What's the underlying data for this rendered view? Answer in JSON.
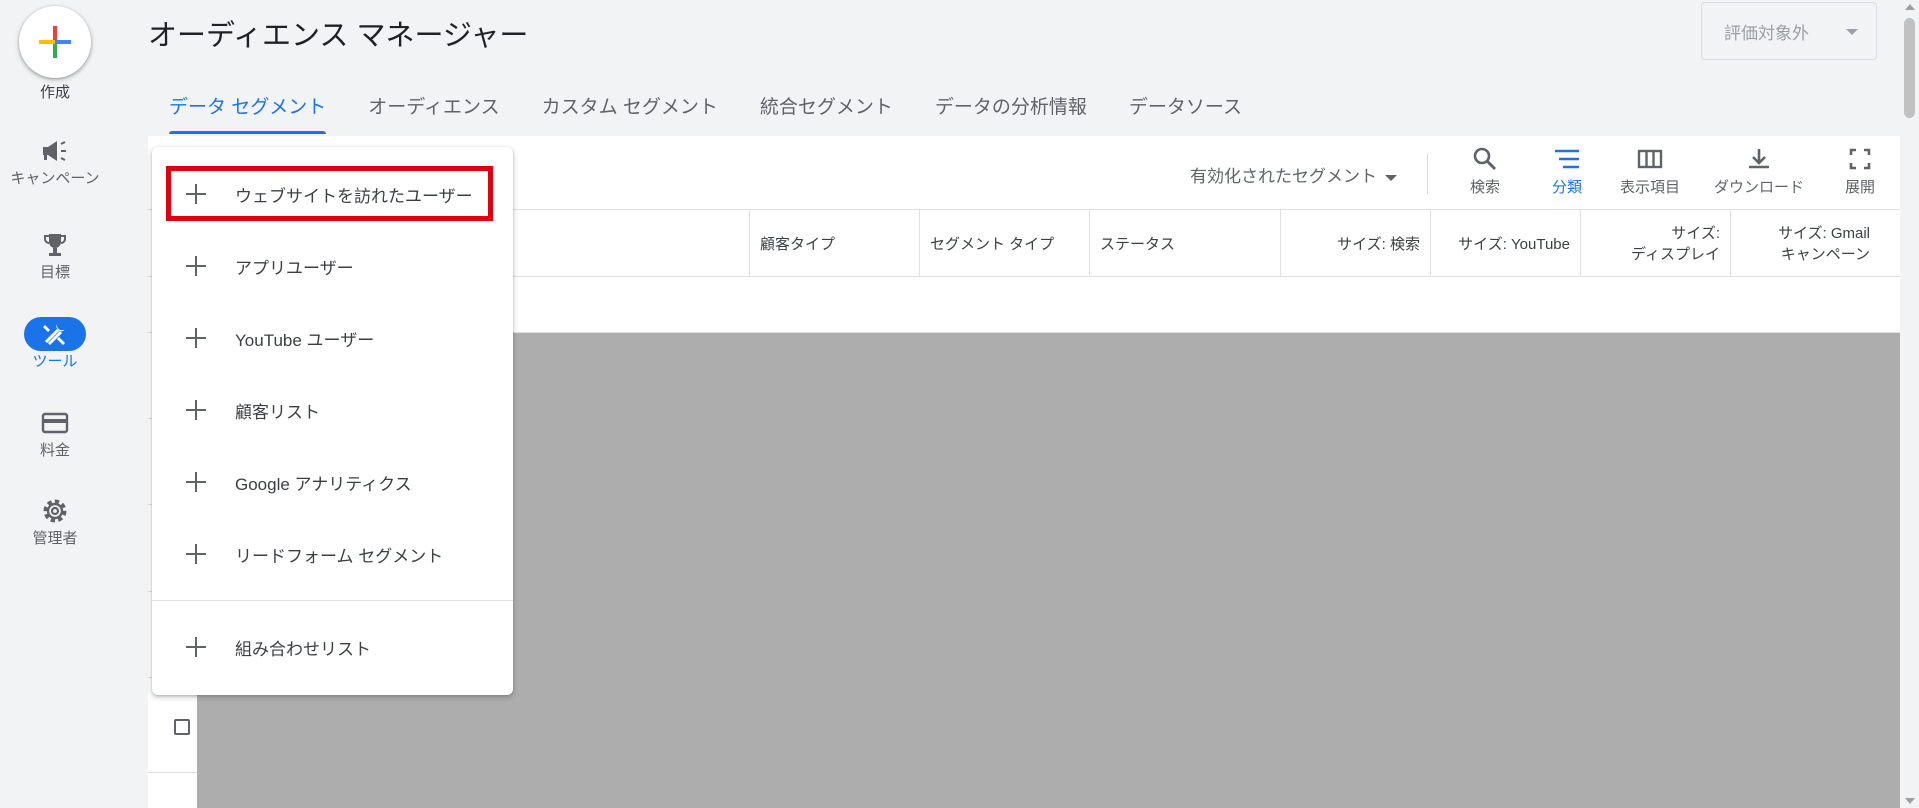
{
  "rail": {
    "create_label": "作成",
    "items": [
      {
        "label": "キャンペーン",
        "icon": "megaphone-icon",
        "active": false
      },
      {
        "label": "目標",
        "icon": "trophy-icon",
        "active": false
      },
      {
        "label": "ツール",
        "icon": "tools-icon",
        "active": true
      },
      {
        "label": "料金",
        "icon": "credit-card-icon",
        "active": false
      },
      {
        "label": "管理者",
        "icon": "gear-icon",
        "active": false
      }
    ]
  },
  "header": {
    "title": "オーディエンス マネージャー",
    "eval_dropdown": "評価対象外"
  },
  "tabs": [
    {
      "label": "データ セグメント",
      "active": true
    },
    {
      "label": "オーディエンス",
      "active": false
    },
    {
      "label": "カスタム セグメント",
      "active": false
    },
    {
      "label": "統合セグメント",
      "active": false
    },
    {
      "label": "データの分析情報",
      "active": false
    },
    {
      "label": "データソース",
      "active": false
    }
  ],
  "toolbar": {
    "segment_filter": "有効化されたセグメント",
    "search": "検索",
    "classify": "分類",
    "columns": "表示項目",
    "download": "ダウンロード",
    "expand": "展開"
  },
  "table": {
    "headers": {
      "customer_type": "顧客タイプ",
      "segment_type": "セグメント タイプ",
      "status": "ステータス",
      "size_search": "サイズ: 検索",
      "size_youtube": "サイズ: YouTube",
      "size_display_1": "サイズ:",
      "size_display_2": "ディスプレイ",
      "size_gmail_1": "サイズ: Gmail",
      "size_gmail_2": "キャンペーン"
    }
  },
  "menu": {
    "items": [
      "ウェブサイトを訪れたユーザー",
      "アプリユーザー",
      "YouTube ユーザー",
      "顧客リスト",
      "Google アナリティクス",
      "リードフォーム セグメント"
    ],
    "combined": "組み合わせリスト"
  },
  "colors": {
    "accent": "#1a73e8",
    "highlight": "#e0000f",
    "redacted": "#adadad"
  }
}
